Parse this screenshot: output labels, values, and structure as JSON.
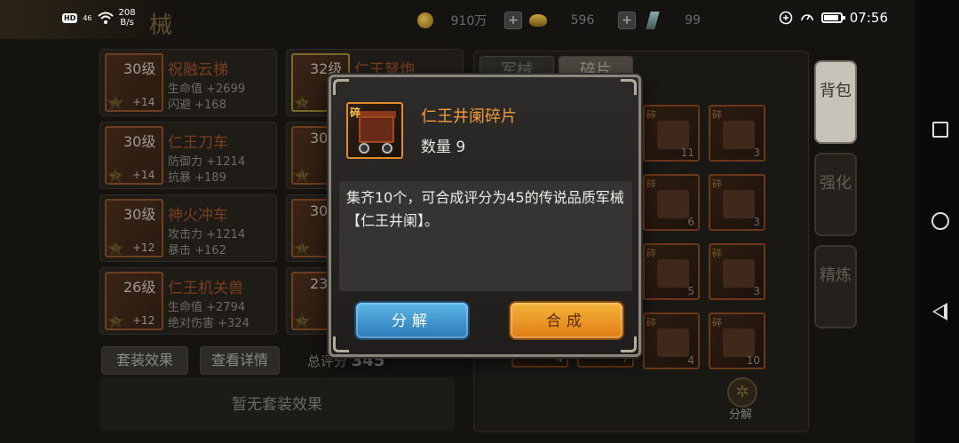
{
  "status_bar": {
    "network": "HD",
    "signal": "46",
    "speed_value": "208",
    "speed_unit": "B/s",
    "time": "07:56",
    "battery_level": 0.8
  },
  "resources": {
    "silver": "910万",
    "gold": "596",
    "gems": "99"
  },
  "weapons": [
    {
      "level": "30级",
      "stars": "40",
      "plus": "+14",
      "name": "祝融云梯",
      "stat1": "生命值 +2699",
      "stat2": "闪避 +168"
    },
    {
      "level": "32级",
      "stars": "45",
      "plus": "",
      "name": "仁王弩炮",
      "stat1": "",
      "stat2": ""
    },
    {
      "level": "30级",
      "stars": "45",
      "plus": "+14",
      "name": "仁王刀车",
      "stat1": "防御力 +1214",
      "stat2": "抗暴 +189"
    },
    {
      "level": "30",
      "stars": "40",
      "plus": "",
      "name": "",
      "stat1": "",
      "stat2": ""
    },
    {
      "level": "30级",
      "stars": "45",
      "plus": "+12",
      "name": "神火冲车",
      "stat1": "攻击力 +1214",
      "stat2": "暴击 +162"
    },
    {
      "level": "30",
      "stars": "40",
      "plus": "",
      "name": "",
      "stat1": "",
      "stat2": ""
    },
    {
      "level": "26级",
      "stars": "45",
      "plus": "+12",
      "name": "仁王机关兽",
      "stat1": "生命值 +2794",
      "stat2": "绝对伤害 +324"
    },
    {
      "level": "23",
      "stars": "45",
      "plus": "",
      "name": "",
      "stat1": "",
      "stat2": ""
    }
  ],
  "left_buttons": {
    "set_effect": "套装效果",
    "view_details": "查看详情"
  },
  "total_score": {
    "label": "总评分",
    "value": "345"
  },
  "no_set_effect": "暂无套装效果",
  "grid_tabs": {
    "weapons": "军械",
    "fragments": "碎片"
  },
  "fragments": [
    {
      "tag": "碎",
      "count": "11"
    },
    {
      "tag": "碎",
      "count": "3"
    },
    {
      "tag": "碎",
      "count": "6"
    },
    {
      "tag": "碎",
      "count": "3"
    },
    {
      "tag": "碎",
      "count": "5"
    },
    {
      "tag": "碎",
      "count": "3"
    },
    {
      "tag": "碎",
      "count": "4"
    },
    {
      "tag": "碎",
      "count": "10"
    }
  ],
  "hidden_counts": [
    "4",
    "7"
  ],
  "decompose_label": "分解",
  "side_tabs": {
    "bag": "背包",
    "enhance": "强化",
    "refine": "精炼"
  },
  "modal": {
    "tag": "碎",
    "name": "仁王井阑碎片",
    "quantity": "数量 9",
    "description": "集齐10个，可合成评分为45的传说品质军械【仁王井阑】。",
    "decompose_button": "分解",
    "combine_button": "合成"
  }
}
